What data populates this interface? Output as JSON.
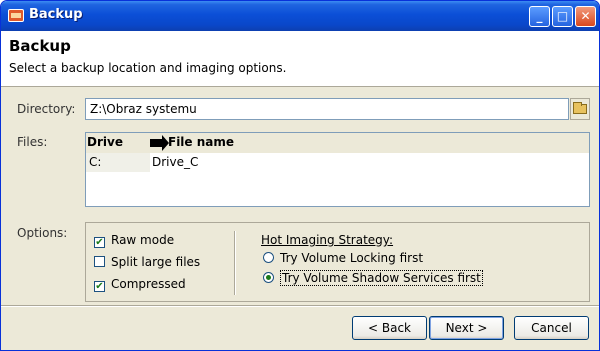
{
  "window": {
    "title": "Backup"
  },
  "header": {
    "title": "Backup",
    "subtitle": "Select a backup location and imaging options."
  },
  "directory": {
    "label": "Directory:",
    "value": "Z:\\Obraz systemu"
  },
  "files": {
    "label": "Files:",
    "columns": {
      "drive": "Drive",
      "file": "File name"
    },
    "rows": [
      {
        "drive": "C:",
        "file": "Drive_C"
      }
    ]
  },
  "options": {
    "label": "Options:",
    "checkboxes": [
      {
        "label": "Raw mode",
        "checked": true
      },
      {
        "label": "Split large files",
        "checked": false
      },
      {
        "label": "Compressed",
        "checked": true
      }
    ],
    "strategy": {
      "title": "Hot Imaging Strategy:",
      "choices": [
        {
          "label": "Try Volume Locking first",
          "selected": false
        },
        {
          "label": "Try Volume Shadow Services first",
          "selected": true
        }
      ]
    }
  },
  "buttons": {
    "back": "< Back",
    "next": "Next >",
    "cancel": "Cancel"
  }
}
